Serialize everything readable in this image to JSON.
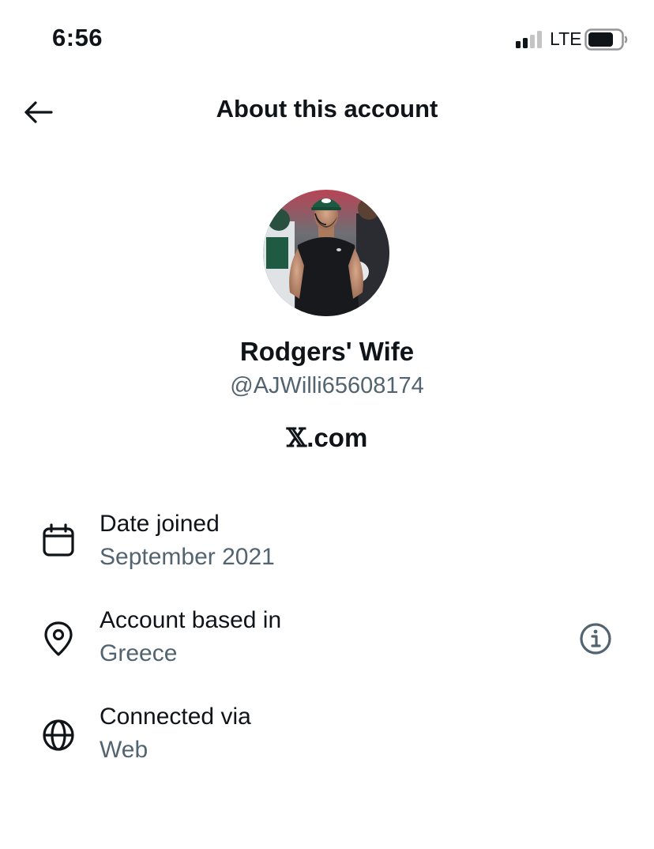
{
  "status_bar": {
    "time": "6:56",
    "network": "LTE"
  },
  "header": {
    "title": "About this account",
    "back_icon": "arrow-left-icon"
  },
  "profile": {
    "display_name": "Rodgers' Wife",
    "handle": "@AJWilli65608174",
    "site_logo": "𝕏",
    "site_suffix": ".com"
  },
  "details": [
    {
      "icon": "calendar-icon",
      "label": "Date joined",
      "value": "September 2021"
    },
    {
      "icon": "location-pin-icon",
      "label": "Account based in",
      "value": "Greece",
      "action_icon": "info-icon"
    },
    {
      "icon": "globe-icon",
      "label": "Connected via",
      "value": "Web"
    }
  ],
  "colors": {
    "primary_text": "#0f1419",
    "secondary_text": "#536471",
    "background": "#ffffff"
  }
}
